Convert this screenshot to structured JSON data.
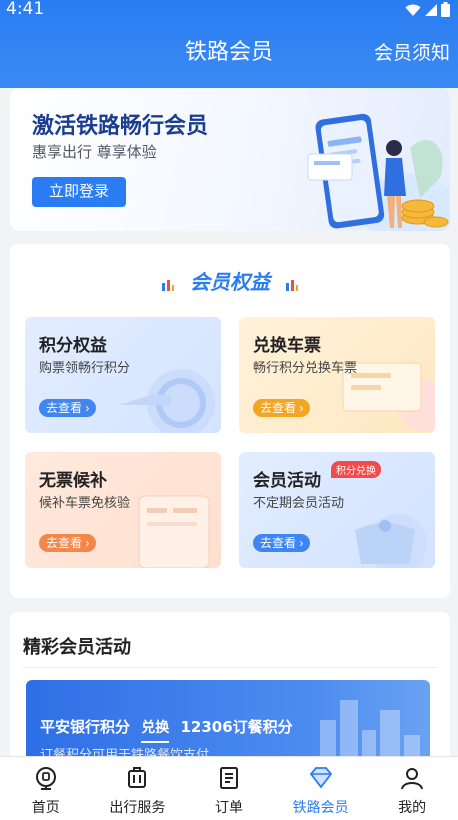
{
  "status_bar": {
    "time": "4:41"
  },
  "header": {
    "title": "铁路会员",
    "right_link": "会员须知"
  },
  "banner": {
    "title": "激活铁路畅行会员",
    "subtitle": "惠享出行 尊享体验",
    "login_button": "立即登录"
  },
  "benefits": {
    "title": "会员权益",
    "cards": [
      {
        "title": "积分权益",
        "subtitle": "购票领畅行积分",
        "button": "去查看",
        "accent": "#3f86f2"
      },
      {
        "title": "兑换车票",
        "subtitle": "畅行积分兑换车票",
        "button": "去查看",
        "accent": "#f3a623"
      },
      {
        "title": "无票候补",
        "subtitle": "候补车票免核验",
        "button": "去查看",
        "accent": "#f3874a"
      },
      {
        "title": "会员活动",
        "subtitle": "不定期会员活动",
        "button": "去查看",
        "tag": "积分兑换",
        "accent": "#3f86f2"
      }
    ]
  },
  "activities": {
    "title": "精彩会员活动",
    "banner": {
      "left": "平安银行积分",
      "swap": "兑换",
      "right": "12306订餐积分",
      "subtitle": "订餐积分可用于铁路餐饮支付"
    }
  },
  "tabbar": {
    "items": [
      {
        "label": "首页",
        "icon": "train-station-icon"
      },
      {
        "label": "出行服务",
        "icon": "luggage-icon"
      },
      {
        "label": "订单",
        "icon": "order-icon"
      },
      {
        "label": "铁路会员",
        "icon": "diamond-icon",
        "active": true
      },
      {
        "label": "我的",
        "icon": "person-icon"
      }
    ]
  },
  "colors": {
    "primary": "#2a7cf2",
    "orange": "#f3a623",
    "red_tag": "#f24b4b"
  }
}
